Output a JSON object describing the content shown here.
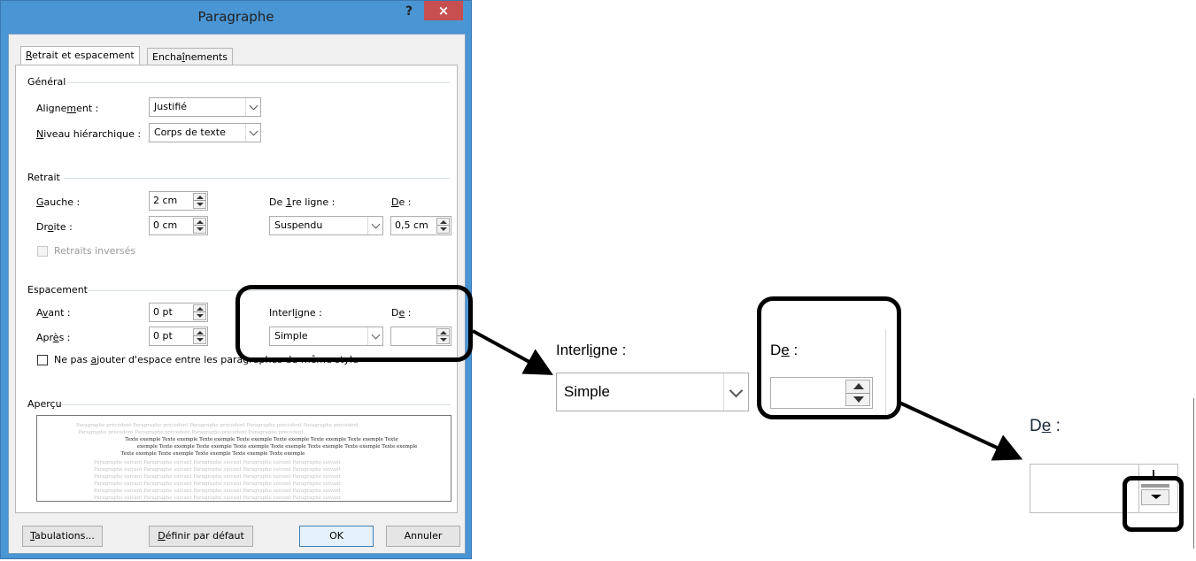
{
  "dialog": {
    "title": "Paragraphe",
    "help": "?",
    "close": "×",
    "tabs": [
      {
        "prefix": "",
        "mnemonic": "R",
        "rest": "etrait et espacement"
      },
      {
        "prefix": "Encha",
        "mnemonic": "î",
        "rest": "nements"
      }
    ],
    "general": {
      "title": "Général",
      "alignment_label": {
        "prefix": "Aligne",
        "mnemonic": "m",
        "rest": "ent :"
      },
      "alignment_value": "Justifié",
      "level_label": {
        "prefix": "",
        "mnemonic": "N",
        "rest": "iveau hiérarchique :"
      },
      "level_value": "Corps de texte"
    },
    "indent": {
      "title": "Retrait",
      "left_label": {
        "prefix": "",
        "mnemonic": "G",
        "rest": "auche :"
      },
      "left_value": "2 cm",
      "right_label": {
        "prefix": "Dr",
        "mnemonic": "o",
        "rest": "ite :"
      },
      "right_value": "0 cm",
      "first_line_label": {
        "prefix": "De ",
        "mnemonic": "1",
        "rest": "re ligne :"
      },
      "first_line_value": "Suspendu",
      "by_label": {
        "prefix": "",
        "mnemonic": "D",
        "rest": "e :"
      },
      "by_value": "0,5 cm",
      "mirror_label": "Retraits inversés"
    },
    "spacing": {
      "title": "Espacement",
      "before_label": {
        "prefix": "A",
        "mnemonic": "v",
        "rest": "ant :"
      },
      "before_value": "0 pt",
      "after_label": {
        "prefix": "Apr",
        "mnemonic": "è",
        "rest": "s :"
      },
      "after_value": "0 pt",
      "line_spacing_label": {
        "prefix": "Interl",
        "mnemonic": "i",
        "rest": "gne :"
      },
      "line_spacing_value": "Simple",
      "at_label": {
        "prefix": "D",
        "mnemonic": "e",
        "rest": " :"
      },
      "at_value": "",
      "no_space_label": {
        "prefix": "Ne pas ",
        "mnemonic": "a",
        "rest": "jouter d'espace entre les paragraphes du même style"
      }
    },
    "preview": {
      "title": "Aperçu",
      "prev_line_1": "Paragraphe précédent Paragraphe précédent Paragraphe précédent Paragraphe précédent Paragraphe précédent",
      "prev_line_2": "Paragraphe précédent Paragraphe précédent Paragraphe précédent Paragraphe précédent",
      "sample_1": "Texte exemple Texte exemple Texte exemple Texte exemple Texte exemple Texte exemple Texte exemple Texte",
      "sample_2": "exemple Texte exemple Texte exemple Texte exemple Texte exemple Texte exemple Texte exemple Texte exemple",
      "sample_3": "Texte exemple Texte exemple Texte exemple Texte exemple Texte exemple",
      "next_line": "Paragraphe suivant Paragraphe suivant Paragraphe suivant Paragraphe suivant Paragraphe suivant"
    },
    "buttons": {
      "tabs_button": {
        "prefix": "",
        "mnemonic": "T",
        "rest": "abulations..."
      },
      "default_button": {
        "prefix": "",
        "mnemonic": "D",
        "rest": "éfinir par défaut"
      },
      "ok": "OK",
      "cancel": "Annuler"
    }
  },
  "zoom1": {
    "line_spacing_label": {
      "prefix": "Interl",
      "mnemonic": "i",
      "rest": "gne :"
    },
    "line_spacing_value": "Simple",
    "at_label": {
      "prefix": "D",
      "mnemonic": "e",
      "rest": " :"
    },
    "at_value": ""
  },
  "zoom2": {
    "at_label": {
      "prefix": "D",
      "mnemonic": "e",
      "rest": " :"
    },
    "at_value": ""
  },
  "icons": {
    "spin_up": "arrow-up-icon",
    "spin_down": "arrow-down-icon",
    "dropdown": "chevron-down-icon"
  }
}
